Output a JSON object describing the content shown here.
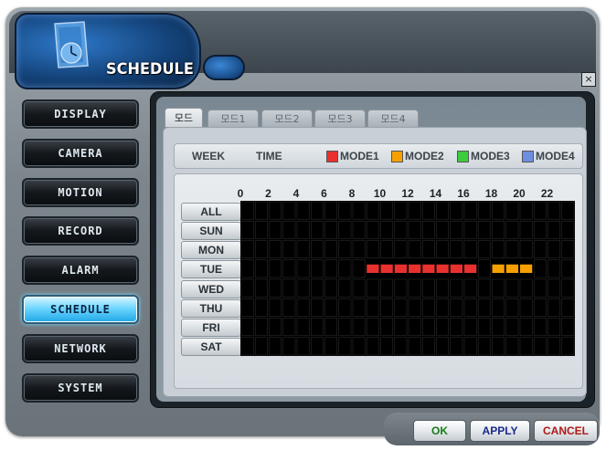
{
  "window": {
    "title": "SCHEDULE",
    "close_glyph": "×"
  },
  "sidebar": {
    "items": [
      {
        "label": "DISPLAY",
        "active": false
      },
      {
        "label": "CAMERA",
        "active": false
      },
      {
        "label": "MOTION",
        "active": false
      },
      {
        "label": "RECORD",
        "active": false
      },
      {
        "label": "ALARM",
        "active": false
      },
      {
        "label": "SCHEDULE",
        "active": true
      },
      {
        "label": "NETWORK",
        "active": false
      },
      {
        "label": "SYSTEM",
        "active": false
      }
    ]
  },
  "tabs": [
    {
      "label": "모드",
      "active": true
    },
    {
      "label": "모드1",
      "active": false
    },
    {
      "label": "모드2",
      "active": false
    },
    {
      "label": "모드3",
      "active": false
    },
    {
      "label": "모드4",
      "active": false
    }
  ],
  "legend": {
    "week_label": "WEEK",
    "time_label": "TIME",
    "modes": [
      {
        "label": "MODE1",
        "color": "#e8312f"
      },
      {
        "label": "MODE2",
        "color": "#f5a000"
      },
      {
        "label": "MODE3",
        "color": "#3ccc3c"
      },
      {
        "label": "MODE4",
        "color": "#6d8fe0"
      }
    ]
  },
  "schedule": {
    "hour_labels": [
      "0",
      "2",
      "4",
      "6",
      "8",
      "10",
      "12",
      "14",
      "16",
      "18",
      "20",
      "22"
    ],
    "days": [
      "ALL",
      "SUN",
      "MON",
      "TUE",
      "WED",
      "THU",
      "FRI",
      "SAT"
    ],
    "slots_per_day": 24,
    "blocks": [
      {
        "day": "TUE",
        "start": 9,
        "end": 17,
        "mode": "MODE1"
      },
      {
        "day": "TUE",
        "start": 18,
        "end": 21,
        "mode": "MODE2"
      }
    ]
  },
  "actions": {
    "ok": "OK",
    "apply": "APPLY",
    "cancel": "CANCEL",
    "ok_color": "#1a7a1a",
    "apply_color": "#1a2a8c",
    "cancel_color": "#b01818"
  }
}
